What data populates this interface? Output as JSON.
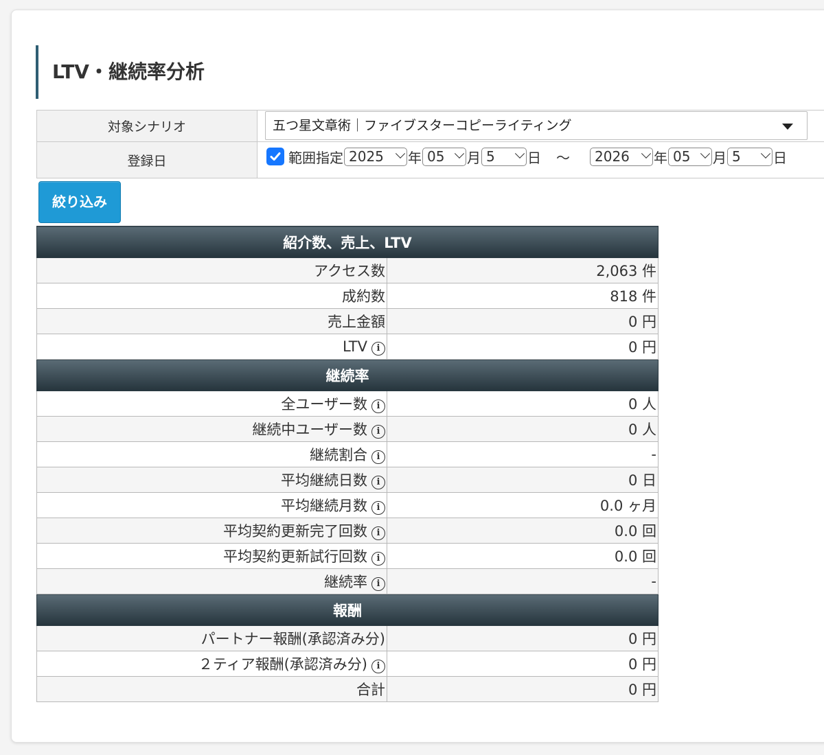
{
  "page": {
    "title": "LTV・継続率分析"
  },
  "filter": {
    "scenario_label": "対象シナリオ",
    "scenario_value": "五つ星文章術｜ファイブスターコピーライティング",
    "date_label": "登録日",
    "range_label": "範囲指定",
    "range_checked": true,
    "from": {
      "year": "2025",
      "month": "05",
      "day": "5"
    },
    "to": {
      "year": "2026",
      "month": "05",
      "day": "5"
    },
    "year_unit": "年",
    "month_unit": "月",
    "day_unit": "日",
    "tilde": "～",
    "submit_label": "絞り込み"
  },
  "sections": [
    {
      "title": "紹介数、売上、LTV",
      "rows": [
        {
          "label": "アクセス数",
          "value": "2,063 件",
          "info": false
        },
        {
          "label": "成約数",
          "value": "818 件",
          "info": false
        },
        {
          "label": "売上金額",
          "value": "0 円",
          "info": false
        },
        {
          "label": "LTV",
          "value": "0 円",
          "info": true
        }
      ]
    },
    {
      "title": "継続率",
      "rows": [
        {
          "label": "全ユーザー数",
          "value": "0 人",
          "info": true
        },
        {
          "label": "継続中ユーザー数",
          "value": "0 人",
          "info": true
        },
        {
          "label": "継続割合",
          "value": "-",
          "info": true
        },
        {
          "label": "平均継続日数",
          "value": "0 日",
          "info": true
        },
        {
          "label": "平均継続月数",
          "value": "0.0 ヶ月",
          "info": true
        },
        {
          "label": "平均契約更新完了回数",
          "value": "0.0 回",
          "info": true
        },
        {
          "label": "平均契約更新試行回数",
          "value": "0.0 回",
          "info": true
        },
        {
          "label": "継続率",
          "value": "-",
          "info": true
        }
      ]
    },
    {
      "title": "報酬",
      "rows": [
        {
          "label": "パートナー報酬(承認済み分)",
          "value": "0 円",
          "info": false
        },
        {
          "label": "２ティア報酬(承認済み分)",
          "value": "0 円",
          "info": true
        },
        {
          "label": "合計",
          "value": "0 円",
          "info": false
        }
      ]
    }
  ],
  "icons": {
    "info": "info-circle-icon",
    "check": "checkmark-icon",
    "dropdown": "chevron-down-icon"
  },
  "colors": {
    "accent": "#1f9ad6",
    "title_bar": "#2f5e73",
    "section_header": "#2e3d45",
    "checkbox": "#1677ff"
  }
}
